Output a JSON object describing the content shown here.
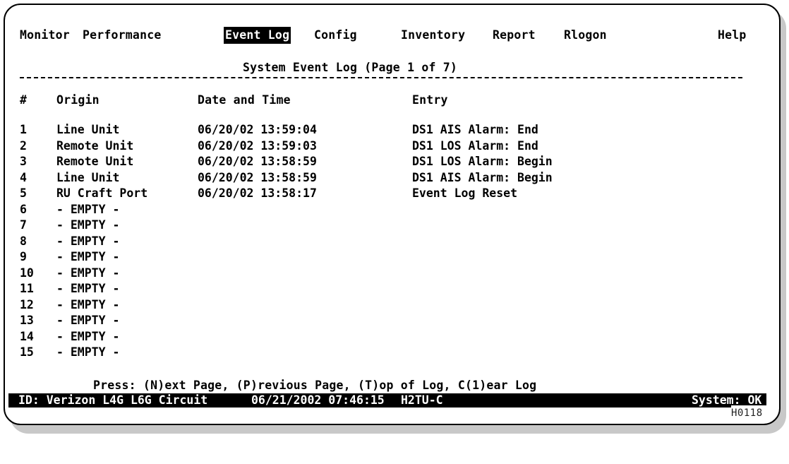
{
  "menu": {
    "items": [
      "Monitor",
      "Performance",
      "Event Log",
      "Config",
      "Inventory",
      "Report",
      "Rlogon"
    ],
    "help": "Help",
    "selected": "Event Log"
  },
  "page_title": "System Event Log (Page 1 of 7)",
  "columns": {
    "num": "#",
    "origin": "Origin",
    "datetime": "Date and Time",
    "entry": "Entry"
  },
  "rows": [
    {
      "num": "1",
      "origin": "Line Unit",
      "datetime": "06/20/02 13:59:04",
      "entry": "DS1 AIS Alarm: End"
    },
    {
      "num": "2",
      "origin": "Remote Unit",
      "datetime": "06/20/02 13:59:03",
      "entry": "DS1 LOS Alarm: End"
    },
    {
      "num": "3",
      "origin": "Remote Unit",
      "datetime": "06/20/02 13:58:59",
      "entry": "DS1 LOS Alarm: Begin"
    },
    {
      "num": "4",
      "origin": "Line Unit",
      "datetime": "06/20/02 13:58:59",
      "entry": "DS1 AIS Alarm: Begin"
    },
    {
      "num": "5",
      "origin": "RU Craft Port",
      "datetime": "06/20/02 13:58:17",
      "entry": "Event Log Reset"
    },
    {
      "num": "6",
      "origin": "- EMPTY -",
      "datetime": "",
      "entry": ""
    },
    {
      "num": "7",
      "origin": "- EMPTY -",
      "datetime": "",
      "entry": ""
    },
    {
      "num": "8",
      "origin": "- EMPTY -",
      "datetime": "",
      "entry": ""
    },
    {
      "num": "9",
      "origin": "- EMPTY -",
      "datetime": "",
      "entry": ""
    },
    {
      "num": "10",
      "origin": "- EMPTY -",
      "datetime": "",
      "entry": ""
    },
    {
      "num": "11",
      "origin": "- EMPTY -",
      "datetime": "",
      "entry": ""
    },
    {
      "num": "12",
      "origin": "- EMPTY -",
      "datetime": "",
      "entry": ""
    },
    {
      "num": "13",
      "origin": "- EMPTY -",
      "datetime": "",
      "entry": ""
    },
    {
      "num": "14",
      "origin": "- EMPTY -",
      "datetime": "",
      "entry": ""
    },
    {
      "num": "15",
      "origin": "- EMPTY -",
      "datetime": "",
      "entry": ""
    }
  ],
  "press_line": "Press: (N)ext Page, (P)revious Page, (T)op of Log, C(1)ear Log",
  "status": {
    "id": "ID: Verizon L4G L6G Circuit",
    "datetime": "06/21/2002 07:46:15",
    "unit": "H2TU-C",
    "system": "System: OK"
  },
  "figure_code": "H0118"
}
